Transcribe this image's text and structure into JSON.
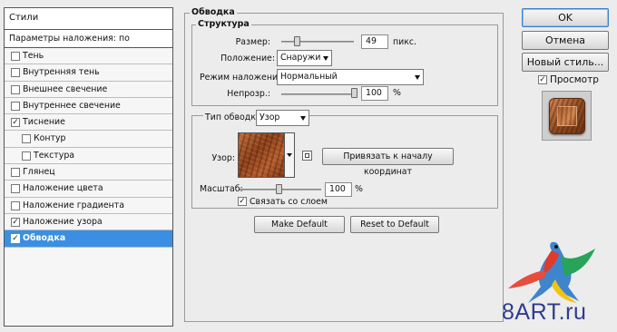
{
  "styles_panel": {
    "header": "Стили",
    "blending_default": "Параметры наложения: по умолчанию",
    "items": [
      {
        "label": "Тень",
        "checked": false
      },
      {
        "label": "Внутренняя тень",
        "checked": false
      },
      {
        "label": "Внешнее свечение",
        "checked": false
      },
      {
        "label": "Внутреннее свечение",
        "checked": false
      },
      {
        "label": "Тиснение",
        "checked": true
      },
      {
        "label": "Контур",
        "checked": false,
        "sub": true
      },
      {
        "label": "Текстура",
        "checked": false,
        "sub": true
      },
      {
        "label": "Глянец",
        "checked": false
      },
      {
        "label": "Наложение цвета",
        "checked": false
      },
      {
        "label": "Наложение градиента",
        "checked": false
      },
      {
        "label": "Наложение узора",
        "checked": true
      },
      {
        "label": "Обводка",
        "checked": true,
        "selected": true
      }
    ]
  },
  "stroke": {
    "title": "Обводка",
    "structure": {
      "title": "Структура",
      "size_label": "Размер:",
      "size_value": "49",
      "size_unit": "пикс.",
      "position_label": "Положение:",
      "position_value": "Снаружи",
      "blend_mode_label": "Режим наложения:",
      "blend_mode_value": "Нормальный",
      "opacity_label": "Непрозр.:",
      "opacity_value": "100",
      "opacity_unit": "%"
    },
    "fill": {
      "fill_type_label": "Тип обводки:",
      "fill_type_value": "Узор",
      "pattern_label": "Узор:",
      "snap_button": "Привязать к началу координат",
      "scale_label": "Масштаб:",
      "scale_value": "100",
      "scale_unit": "%",
      "link_label": "Связать со слоем",
      "link_checked": true
    },
    "make_default": "Make Default",
    "reset_default": "Reset to Default"
  },
  "buttons": {
    "ok": "OK",
    "cancel": "Отмена",
    "new_style": "Новый стиль...",
    "preview_label": "Просмотр",
    "preview_checked": true
  },
  "watermark": "8ART.ru",
  "colors": {
    "selection": "#3b8fe2",
    "ok_border": "#3c7fd0",
    "watermark": "#2f3c8f"
  }
}
